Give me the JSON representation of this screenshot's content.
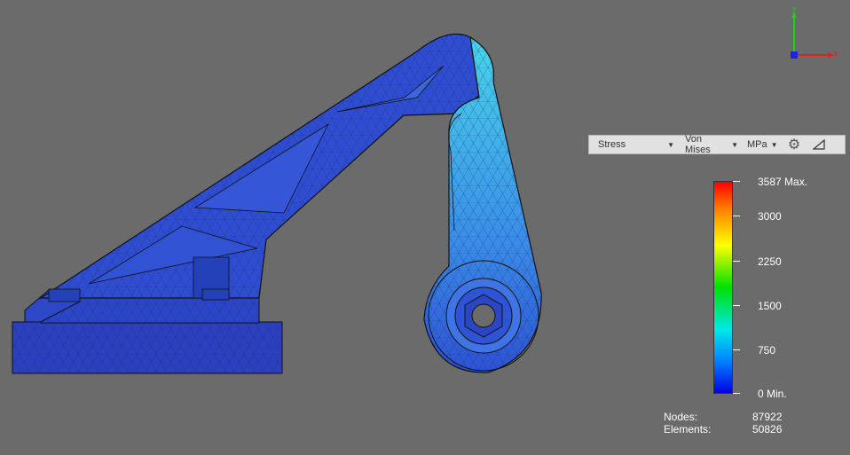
{
  "toolbar": {
    "result_label": "Stress",
    "type_label": "Von Mises",
    "unit_label": "MPa",
    "settings_icon": "gear-icon",
    "resize_icon": "resize-corner-icon"
  },
  "legend": {
    "max_label": "3587 Max.",
    "t3000": "3000",
    "t2250": "2250",
    "t1500": "1500",
    "t750": "750",
    "min_label": "0 Min."
  },
  "stats": {
    "nodes_label": "Nodes:",
    "nodes_value": "87922",
    "elements_label": "Elements:",
    "elements_value": "50826"
  },
  "triad": {
    "y_label": "Y",
    "x_label": "X"
  },
  "colors": {
    "background": "#6b6b6b",
    "mesh_blue": "#2a4fd0",
    "base_blue": "#2b3fbf",
    "high_stress": "#4ad7e8"
  }
}
